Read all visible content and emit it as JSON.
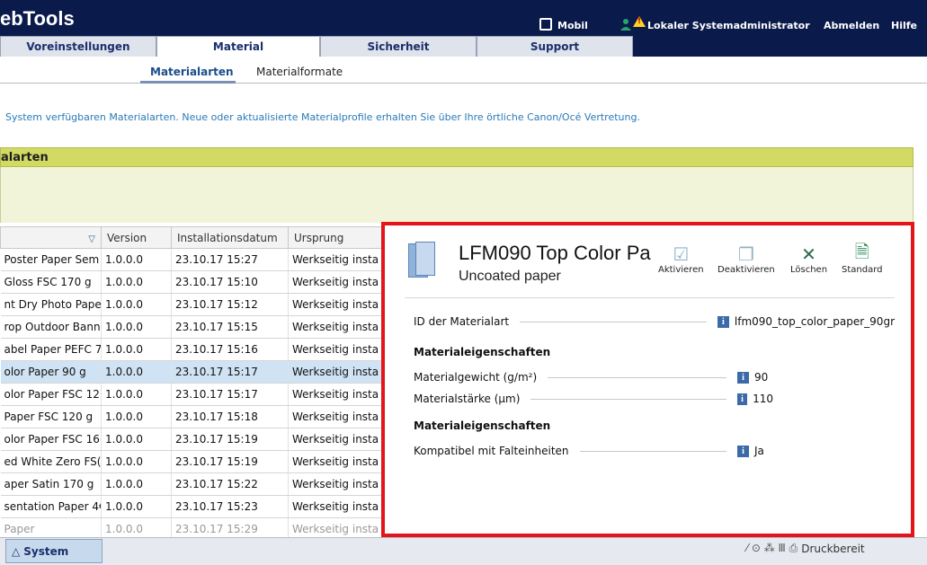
{
  "header": {
    "brand": "ebTools",
    "mobile_label": "Mobil",
    "user_label": "Lokaler Systemadministrator",
    "logout_label": "Abmelden",
    "help_label": "Hilfe"
  },
  "tabs": [
    {
      "label": "Voreinstellungen"
    },
    {
      "label": "Material"
    },
    {
      "label": "Sicherheit"
    },
    {
      "label": "Support"
    }
  ],
  "subtabs": [
    {
      "label": "Materialarten"
    },
    {
      "label": "Materialformate"
    }
  ],
  "description": "System verfügbaren Materialarten. Neue oder aktualisierte Materialprofile erhalten Sie über Ihre örtliche Canon/Océ Vertretung.",
  "panel": {
    "title": "alarten"
  },
  "table": {
    "columns": [
      "",
      "Version",
      "Installationsdatum",
      "Ursprung"
    ],
    "rows": [
      {
        "name": "Poster Paper Sem",
        "version": "1.0.0.0",
        "date": "23.10.17 15:27",
        "origin": "Werkseitig insta"
      },
      {
        "name": "Gloss FSC 170 g",
        "version": "1.0.0.0",
        "date": "23.10.17 15:10",
        "origin": "Werkseitig insta"
      },
      {
        "name": "nt Dry Photo Pape",
        "version": "1.0.0.0",
        "date": "23.10.17 15:12",
        "origin": "Werkseitig insta"
      },
      {
        "name": "rop Outdoor Bann",
        "version": "1.0.0.0",
        "date": "23.10.17 15:15",
        "origin": "Werkseitig insta"
      },
      {
        "name": "abel Paper PEFC 7.",
        "version": "1.0.0.0",
        "date": "23.10.17 15:16",
        "origin": "Werkseitig insta"
      },
      {
        "name": "olor Paper 90 g",
        "version": "1.0.0.0",
        "date": "23.10.17 15:17",
        "origin": "Werkseitig insta"
      },
      {
        "name": "olor Paper FSC 12(",
        "version": "1.0.0.0",
        "date": "23.10.17 15:17",
        "origin": "Werkseitig insta"
      },
      {
        "name": "Paper FSC 120 g",
        "version": "1.0.0.0",
        "date": "23.10.17 15:18",
        "origin": "Werkseitig insta"
      },
      {
        "name": "olor Paper FSC 16(",
        "version": "1.0.0.0",
        "date": "23.10.17 15:19",
        "origin": "Werkseitig insta"
      },
      {
        "name": "ed White Zero FS(",
        "version": "1.0.0.0",
        "date": "23.10.17 15:19",
        "origin": "Werkseitig insta"
      },
      {
        "name": "aper Satin 170 g",
        "version": "1.0.0.0",
        "date": "23.10.17 15:22",
        "origin": "Werkseitig insta"
      },
      {
        "name": "sentation Paper 4€",
        "version": "1.0.0.0",
        "date": "23.10.17 15:23",
        "origin": "Werkseitig insta"
      },
      {
        "name": "Paper",
        "version": "1.0.0.0",
        "date": "23.10.17 15:29",
        "origin": "Werkseitig insta"
      }
    ]
  },
  "bottom": {
    "system_tab": "System",
    "status": "Druckbereit"
  },
  "detail": {
    "title": "LFM090 Top Color Pa",
    "subtitle": "Uncoated paper",
    "actions": [
      {
        "label": "Aktivieren"
      },
      {
        "label": "Deaktivieren"
      },
      {
        "label": "Löschen"
      },
      {
        "label": "Standard"
      }
    ],
    "id_label": "ID der Materialart",
    "id_value": "lfm090_top_color_paper_90gr",
    "section1": "Materialeigenschaften",
    "weight_label": "Materialgewicht (g/m²)",
    "weight_value": "90",
    "thickness_label": "Materialstärke (µm)",
    "thickness_value": "110",
    "section2": "Materialeigenschaften",
    "folder_label": "Kompatibel mit Falteinheiten",
    "folder_value": "Ja"
  }
}
